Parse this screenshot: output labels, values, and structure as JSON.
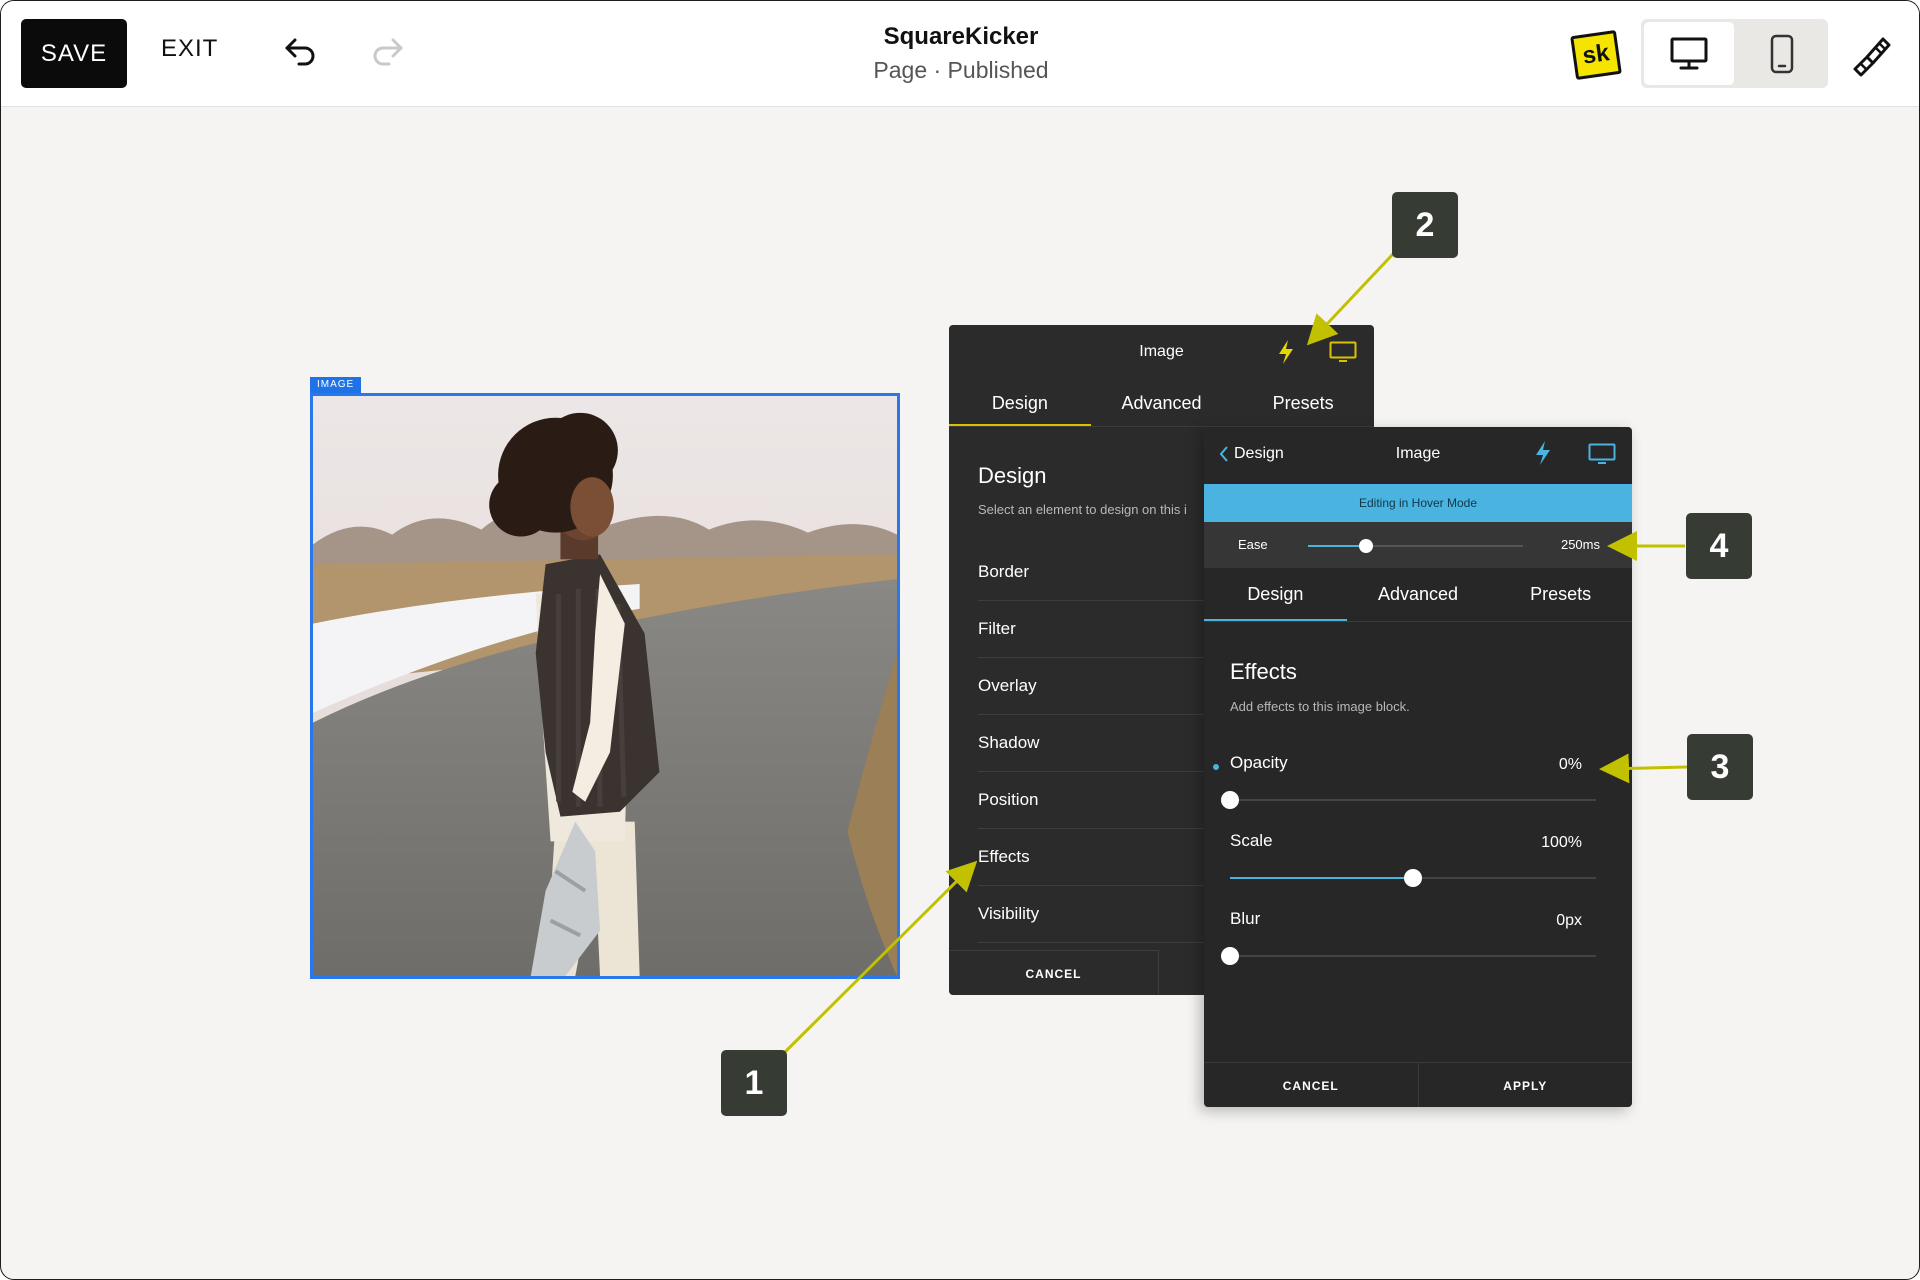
{
  "toolbar": {
    "save_label": "SAVE",
    "exit_label": "EXIT",
    "site_title": "SquareKicker",
    "page_status": "Page · Published",
    "logo_text": "sk"
  },
  "canvas": {
    "image_label": "IMAGE"
  },
  "panel_main": {
    "title": "Image",
    "tabs": [
      {
        "label": "Design",
        "active": true
      },
      {
        "label": "Advanced",
        "active": false
      },
      {
        "label": "Presets",
        "active": false
      }
    ],
    "heading": "Design",
    "subheading": "Select an element to design on this i",
    "items": [
      {
        "label": "Border"
      },
      {
        "label": "Filter"
      },
      {
        "label": "Overlay"
      },
      {
        "label": "Shadow"
      },
      {
        "label": "Position"
      },
      {
        "label": "Effects"
      },
      {
        "label": "Visibility"
      }
    ],
    "cancel_label": "CANCEL"
  },
  "panel_hover": {
    "back_label": "Design",
    "title": "Image",
    "banner": "Editing in Hover Mode",
    "ease": {
      "label": "Ease",
      "value": "250ms",
      "level": 0.27
    },
    "tabs": [
      {
        "label": "Design",
        "active": true
      },
      {
        "label": "Advanced",
        "active": false
      },
      {
        "label": "Presets",
        "active": false
      }
    ],
    "heading": "Effects",
    "subheading": "Add effects to this image block.",
    "controls": [
      {
        "label": "Opacity",
        "value": "0%",
        "level": 0.0,
        "modified": true
      },
      {
        "label": "Scale",
        "value": "100%",
        "level": 0.5,
        "modified": false
      },
      {
        "label": "Blur",
        "value": "0px",
        "level": 0.0,
        "modified": false
      }
    ],
    "cancel_label": "CANCEL",
    "apply_label": "APPLY"
  },
  "callouts": [
    "1",
    "2",
    "3",
    "4"
  ],
  "colors": {
    "accent_yellow": "#d9c300",
    "accent_blue": "#4ab3e0",
    "selection_blue": "#2a77ea",
    "callout_bg": "#363b33"
  },
  "icons": [
    "undo-icon",
    "redo-icon",
    "desktop-icon",
    "mobile-icon",
    "paintbrush-icon",
    "lightning-icon",
    "monitor-icon",
    "chevron-left-icon"
  ]
}
